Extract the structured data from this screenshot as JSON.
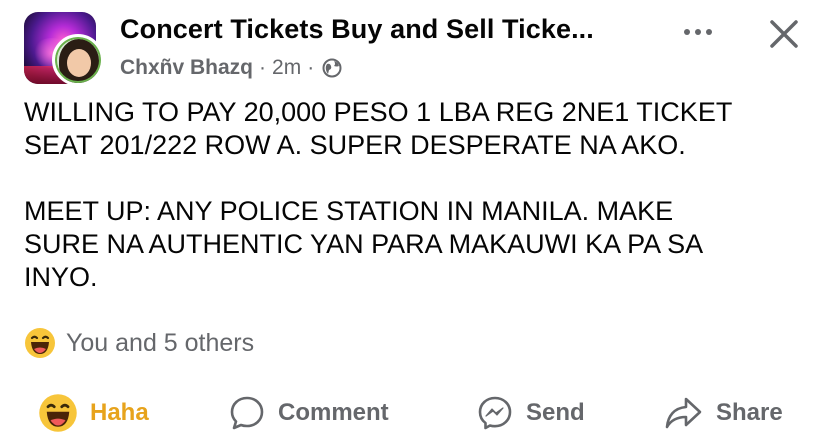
{
  "header": {
    "group_name": "Concert Tickets Buy and Sell Ticke...",
    "author": "Chxñv Bhazq",
    "separator": "·",
    "time": "2m",
    "privacy_icon": "globe-icon"
  },
  "post": {
    "text": "WILLING TO PAY 20,000 PESO 1 LBA REG 2NE1 TICKET\nSEAT 201/222 ROW A. SUPER DESPERATE NA AKO.\n\nMEET UP: ANY POLICE STATION IN MANILA. MAKE\nSURE NA AUTHENTIC YAN PARA MAKAUWI KA PA SA\nINYO."
  },
  "reactions": {
    "icon": "haha-emoji-icon",
    "summary": "You and 5 others"
  },
  "actions": {
    "haha_label": "Haha",
    "comment_label": "Comment",
    "send_label": "Send",
    "share_label": "Share"
  },
  "colors": {
    "haha_active": "#e7a31c",
    "secondary_text": "#65676b",
    "primary_text": "#050505"
  }
}
